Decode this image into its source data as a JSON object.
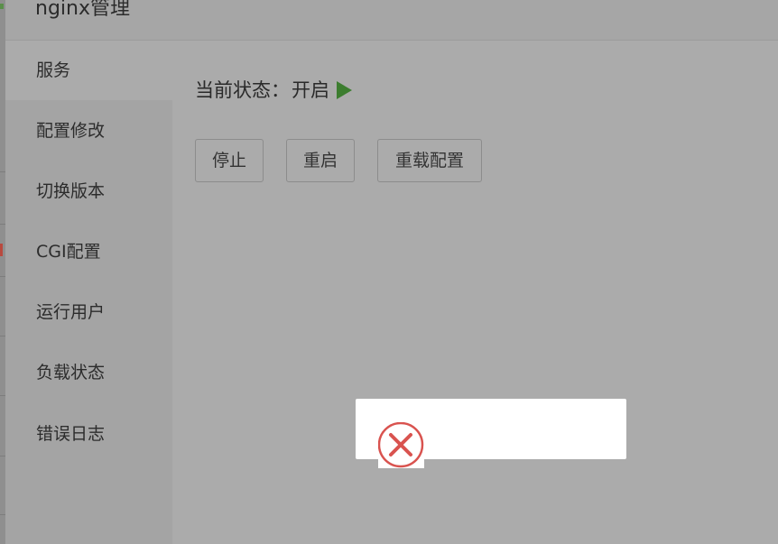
{
  "panel": {
    "title": "nginx管理"
  },
  "sidebar": {
    "items": [
      {
        "label": "服务",
        "active": true
      },
      {
        "label": "配置修改",
        "active": false
      },
      {
        "label": "切换版本",
        "active": false
      },
      {
        "label": "CGI配置",
        "active": false
      },
      {
        "label": "运行用户",
        "active": false
      },
      {
        "label": "负载状态",
        "active": false
      },
      {
        "label": "错误日志",
        "active": false
      }
    ]
  },
  "service": {
    "status_label": "当前状态",
    "status_sep": "：",
    "status_value": "开启",
    "status_icon": "play-icon",
    "status_color": "#3c7d2f",
    "buttons": {
      "stop": "停止",
      "restart": "重启",
      "reload": "重载配置"
    }
  },
  "toast": {
    "icon": "error-circle-icon",
    "icon_color": "#d9534f"
  }
}
